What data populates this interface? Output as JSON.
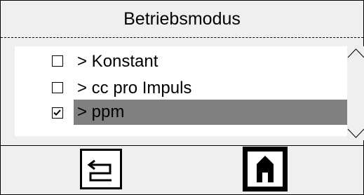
{
  "title": "Betriebsmodus",
  "options": [
    {
      "label": "> Konstant",
      "checked": false
    },
    {
      "label": "> cc pro Impuls",
      "checked": false
    },
    {
      "label": "> ppm",
      "checked": true
    }
  ],
  "icons": {
    "scroll_up": "chevron-up-icon",
    "scroll_down": "chevron-down-icon",
    "back": "back-arrow-icon",
    "home": "home-icon"
  },
  "colors": {
    "background": "#efefef",
    "list_background": "#ffffff",
    "selection": "#808080"
  }
}
